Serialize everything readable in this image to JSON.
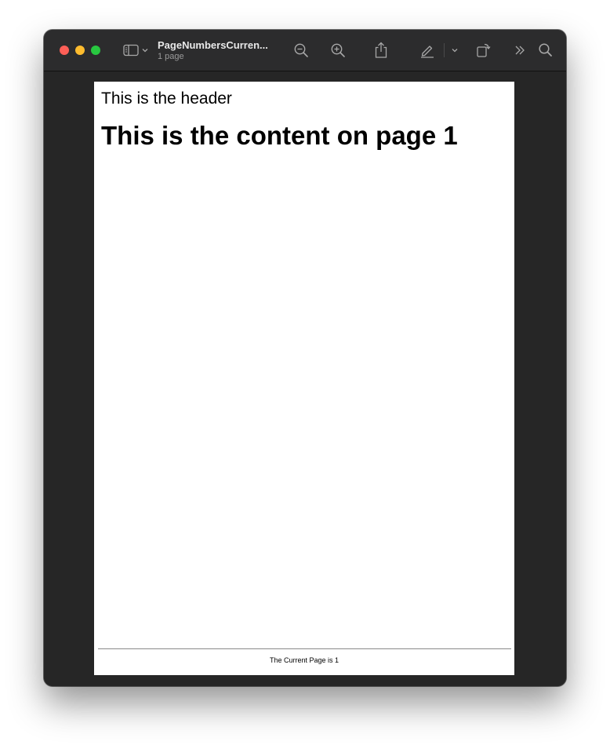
{
  "window": {
    "title": "PageNumbersCurren...",
    "subtitle": "1 page"
  },
  "toolbar": {
    "icons": [
      "sidebar-icon",
      "chevron-down-icon",
      "zoom-out-icon",
      "zoom-in-icon",
      "share-icon",
      "markup-pen-icon",
      "chevron-down-icon",
      "rotate-icon",
      "more-icon",
      "search-icon"
    ]
  },
  "document": {
    "header": "This is the header",
    "content": "This is the content on page 1",
    "footer": "The Current Page is 1"
  },
  "colors": {
    "close": "#fe5f57",
    "minimize": "#febc2e",
    "maximize": "#28c840",
    "chrome": "#2c2c2d",
    "canvas": "#262626"
  }
}
